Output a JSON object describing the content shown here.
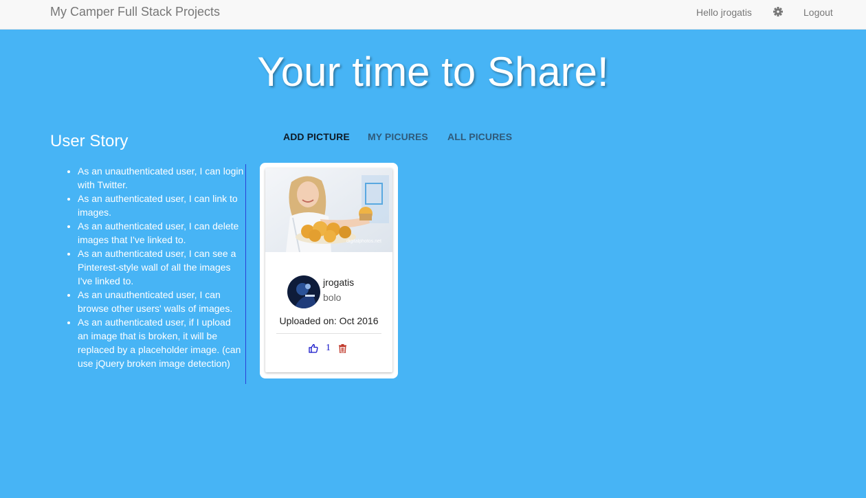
{
  "navbar": {
    "brand": "My Camper Full Stack Projects",
    "greeting": "Hello jrogatis",
    "settings_icon": "gear-icon",
    "logout": "Logout"
  },
  "hero": {
    "title": "Your time to Share!"
  },
  "user_story": {
    "title": "User Story",
    "items": [
      "As an unauthenticated user, I can login with Twitter.",
      "As an authenticated user, I can link to images.",
      "As an authenticated user, I can delete images that I've linked to.",
      "As an authenticated user, I can see a Pinterest-style wall of all the images I've linked to.",
      "As an unauthenticated user, I can browse other users' walls of images.",
      "As an authenticated user, if I upload an image that is broken, it will be replaced by a placeholder image. (can use jQuery broken image detection)"
    ]
  },
  "tabs": {
    "add": "ADD PICTURE",
    "my": "MY PICURES",
    "all": "ALL PICURES"
  },
  "card": {
    "photo_icon": "photo-girl-with-muffins",
    "user_name": "jrogatis",
    "description": "bolo",
    "uploaded": "Uploaded on: Oct 2016",
    "likes": "1",
    "like_icon": "thumbs-up-icon",
    "delete_icon": "trash-icon",
    "watermark": "digitalphotos.net"
  },
  "colors": {
    "background": "#47b4f5",
    "navbar": "#f8f8f8",
    "divider": "#2c3fd6",
    "like": "#1010c8",
    "delete": "#c0392b"
  }
}
